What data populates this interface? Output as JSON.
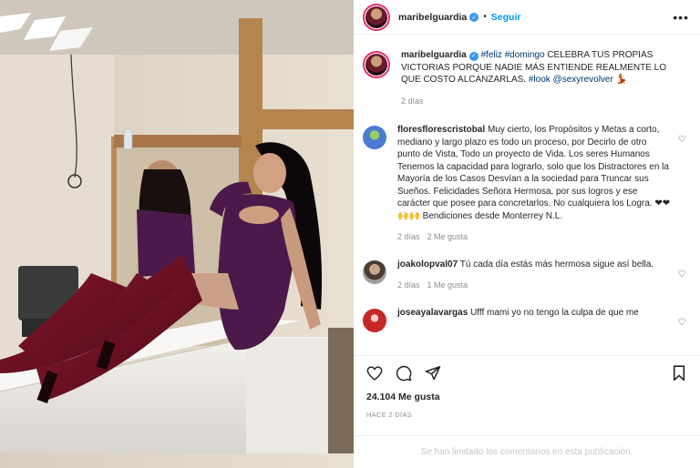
{
  "post": {
    "username": "maribelguardia",
    "follow_label": "Seguir",
    "more_label": "•••"
  },
  "caption": {
    "username": "maribelguardia",
    "text_plain_1": " ",
    "hashtag_feliz": "#feliz",
    "hashtag_domingo": "#domingo",
    "text_line": " CELEBRA TUS PROPIAS VICTORIAS PORQUE NADIE MÁS ENTIENDE REALMENTE LO QUE COSTO ALCANZARLAS. ",
    "hashtag_look": "#look",
    "mention": "@sexyrevolver",
    "emoji": "💃",
    "time": "2 días"
  },
  "comments": [
    {
      "username": "floresflorescristobal",
      "text": "Muy cierto, los Propósitos y Metas a corto, mediano y largo plazo es todo un proceso, por Decirlo de otro punto de Vista, Todo un proyecto de Vida. Los seres Humanos Tenemos la capacidad para lograrlo, solo que los Distractores en la Mayoría de los Casos Desvían a la sociedad para Truncar sus Sueños. Felicidades Señora Hermosa, por sus logros y ese carácter que posee para concretarlos. No cualquiera los Logra. ❤❤🙌🙌 Bendiciones desde Monterrey N.L.",
      "time": "2 días",
      "likes": "2 Me gusta",
      "avatar_color": "#4a7bd1"
    },
    {
      "username": "joakolopval07",
      "text": "Tú cada día estás más hermosa sigue así bella.",
      "time": "2 días",
      "likes": "1 Me gusta",
      "avatar_color": "#7a6a5e"
    },
    {
      "username": "joseayalavargas",
      "text": "Ufff mami yo no tengo la culpa de que me",
      "time": "",
      "likes": "",
      "avatar_color": "#c62828"
    }
  ],
  "icons": {
    "like": "heart-icon",
    "comment": "comment-icon",
    "share": "share-icon",
    "save": "bookmark-icon"
  },
  "stats": {
    "likes": "24.104 Me gusta",
    "posted": "HACE 2 DÍAS"
  },
  "footer": {
    "limited_comments": "Se han limitado los comentarios en esta publicación."
  },
  "colors": {
    "accent": "#0095f6",
    "hashtag": "#00376b",
    "muted": "#8e8e8e",
    "dress": "#4b1a4a",
    "boots": "#6a1020"
  }
}
